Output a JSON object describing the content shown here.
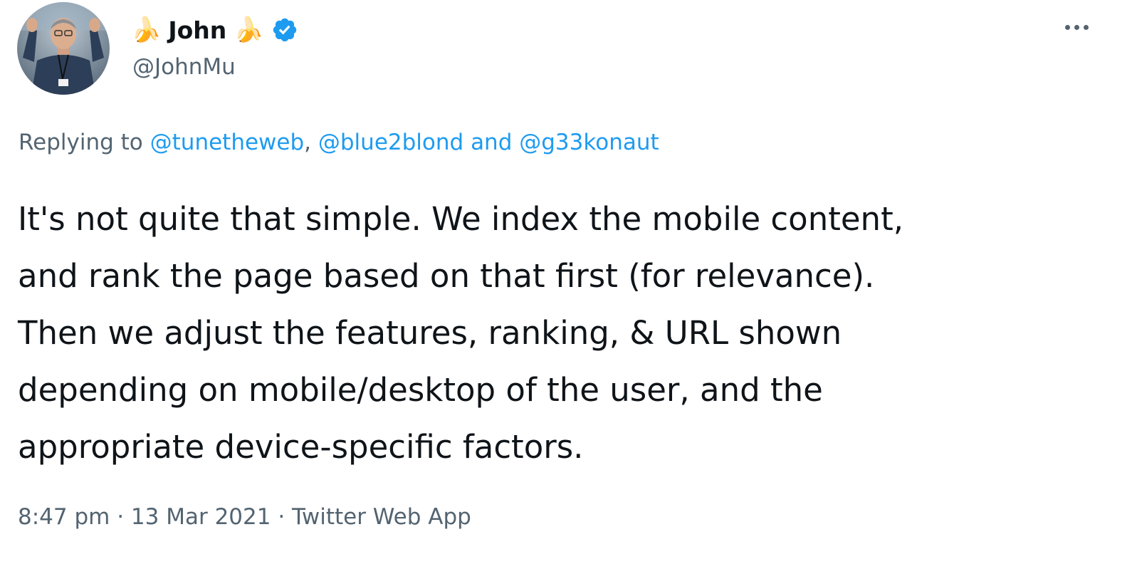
{
  "author": {
    "name_prefix_emoji": "🍌",
    "display_name": "John",
    "name_suffix_emoji": "🍌",
    "handle": "@JohnMu",
    "verified_color": "#1d9bf0"
  },
  "reply": {
    "prefix": "Replying to",
    "mentions": [
      "@tunetheweb",
      "@blue2blond",
      "@g33konaut"
    ],
    "separator": ",",
    "and": "and"
  },
  "tweet": {
    "lines": [
      "It's not quite that simple. We index the mobile content,",
      "and rank the page based on that first (for relevance).",
      "Then we adjust the features, ranking, & URL shown",
      "depending on mobile/desktop of the user, and the",
      "appropriate device-specific factors."
    ]
  },
  "meta": {
    "time": "8:47 pm",
    "dot": "·",
    "date": "13 Mar 2021",
    "source": "Twitter Web App"
  },
  "icons": {
    "more": "more-horizontal-icon",
    "verified": "verified-badge-icon"
  },
  "colors": {
    "link": "#1d9bf0",
    "secondary_text": "#536471",
    "primary_text": "#0f1419"
  }
}
